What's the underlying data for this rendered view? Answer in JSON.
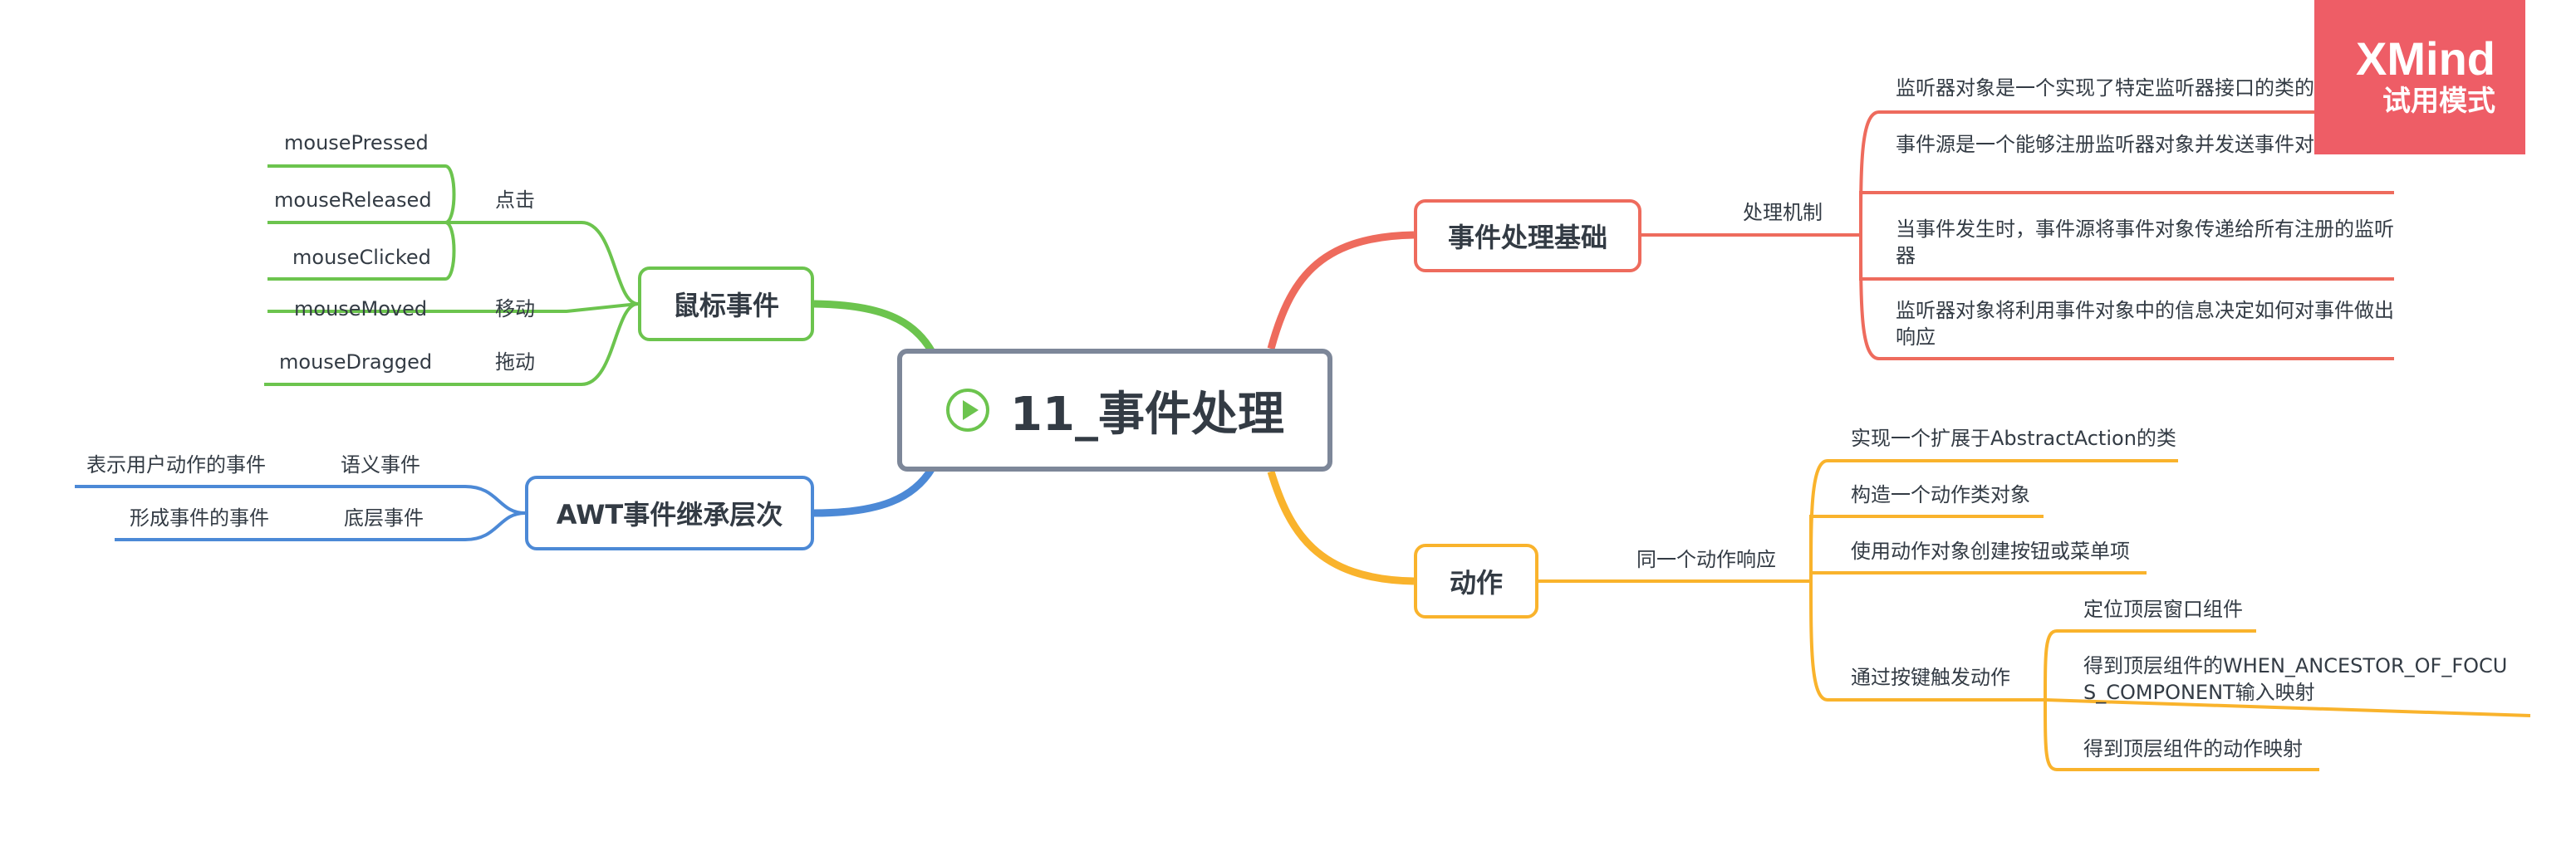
{
  "central": {
    "title": "11_事件处理",
    "icon": "play-icon"
  },
  "colors": {
    "red": "#ee6b5d",
    "orange": "#f9b32c",
    "green": "#6cc44e",
    "blue": "#4c89d6",
    "central_border": "#7d8799"
  },
  "branches": {
    "basics": {
      "title": "事件处理基础",
      "mechanism": {
        "label": "处理机制",
        "items": [
          "监听器对象是一个实现了特定监听器接口的类的实例",
          "事件源是一个能够注册监听器对象并发送事件对象的对象",
          "当事件发生时，事件源将事件对象传递给所有注册的监听器",
          "监听器对象将利用事件对象中的信息决定如何对事件做出响应"
        ]
      }
    },
    "action": {
      "title": "动作",
      "same_response": {
        "label": "同一个动作响应",
        "items": [
          "实现一个扩展于AbstractAction的类",
          "构造一个动作类对象",
          "使用动作对象创建按钮或菜单项",
          "通过按键触发动作"
        ],
        "key_trigger_items": [
          "定位顶层窗口组件",
          "得到顶层组件的WHEN_ANCESTOR_OF_FOCUS_COMPONENT输入映射",
          "得到顶层组件的动作映射"
        ]
      }
    },
    "mouse": {
      "title": "鼠标事件",
      "click": {
        "label": "点击",
        "items": [
          "mousePressed",
          "mouseReleased",
          "mouseClicked"
        ]
      },
      "move": {
        "label": "移动",
        "items": [
          "mouseMoved"
        ]
      },
      "drag": {
        "label": "拖动",
        "items": [
          "mouseDragged"
        ]
      }
    },
    "awt": {
      "title": "AWT事件继承层次",
      "semantic": {
        "label": "语义事件",
        "items": [
          "表示用户动作的事件"
        ]
      },
      "low_level": {
        "label": "底层事件",
        "items": [
          "形成事件的事件"
        ]
      }
    }
  },
  "watermark": {
    "brand": "XMind",
    "subtitle": "试用模式"
  }
}
